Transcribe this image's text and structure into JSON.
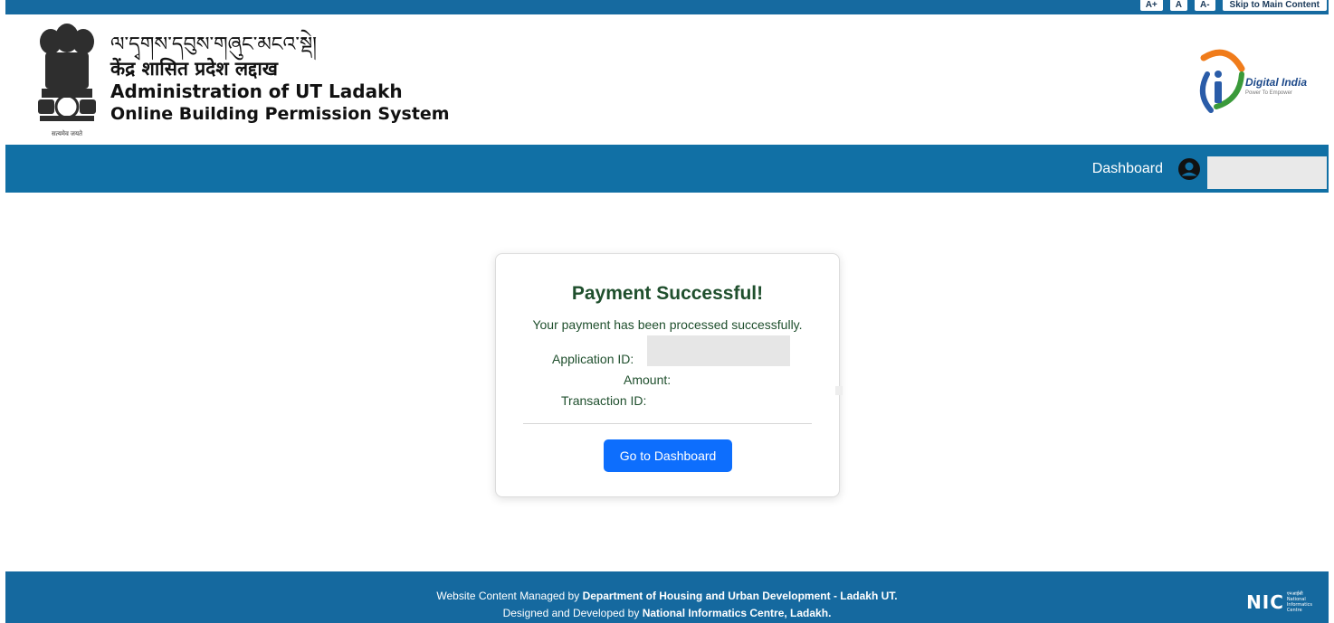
{
  "accessibility": {
    "increase_label": "A+",
    "normal_label": "A",
    "decrease_label": "A-",
    "skip_label": "Skip to Main Content"
  },
  "header": {
    "title_tibetan": "ལ་དྭགས་དབུས་གཞུང་མངའ་སྡེ།",
    "title_hindi": "केंद्र शासित प्रदेश लद्दाख",
    "title_english": "Administration of UT Ladakh",
    "subtitle": "Online Building Permission System",
    "emblem_motto": "सत्यमेव जयते",
    "logo_name": "Digital India",
    "logo_tagline": "Power To Empower"
  },
  "nav": {
    "dashboard_label": "Dashboard",
    "avatar_icon": "user-circle-icon"
  },
  "card": {
    "title": "Payment Successful!",
    "message": "Your payment has been processed successfully.",
    "application_id_label": "Application ID:",
    "amount_label": "Amount:",
    "transaction_id_label": "Transaction ID:",
    "button_label": "Go to Dashboard"
  },
  "footer": {
    "line1_prefix": "Website Content Managed by ",
    "line1_org": "Department of Housing and Urban Development - Ladakh UT.",
    "line2_prefix": "Designed and Developed by ",
    "line2_org": "National Informatics Centre, Ladakh.",
    "nic_logo": "NIC",
    "nic_hindi": "एनआईसी",
    "nic_small1": "National",
    "nic_small2": "Informatics",
    "nic_small3": "Centre"
  },
  "colors": {
    "header_blue": "#166aa0",
    "navbar_blue": "#1170a5",
    "success_green": "#1f4f2d",
    "button_blue": "#0d6efd"
  }
}
